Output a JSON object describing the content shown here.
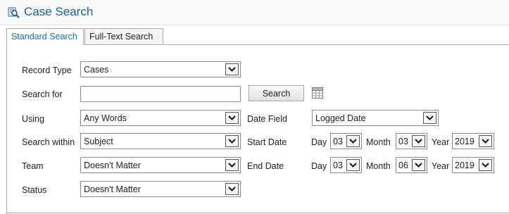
{
  "header": {
    "title": "Case Search",
    "icon": "search-case-icon"
  },
  "tabs": [
    {
      "label": "Standard Search",
      "active": true
    },
    {
      "label": "Full-Text Search",
      "active": false
    }
  ],
  "form": {
    "record_type": {
      "label": "Record Type",
      "value": "Cases"
    },
    "search_for": {
      "label": "Search for",
      "value": "",
      "placeholder": ""
    },
    "search_button": "Search",
    "calendar_icon": "calendar-grid-icon",
    "using": {
      "label": "Using",
      "value": "Any Words"
    },
    "search_within": {
      "label": "Search within",
      "value": "Subject"
    },
    "team": {
      "label": "Team",
      "value": "Doesn't Matter"
    },
    "status": {
      "label": "Status",
      "value": "Doesn't Matter"
    },
    "date_field": {
      "label": "Date Field",
      "value": "Logged Date"
    },
    "start_date": {
      "label": "Start Date",
      "day_label": "Day",
      "day": "03",
      "month_label": "Month",
      "month": "03",
      "year_label": "Year",
      "year": "2019"
    },
    "end_date": {
      "label": "End Date",
      "day_label": "Day",
      "day": "03",
      "month_label": "Month",
      "month": "06",
      "year_label": "Year",
      "year": "2019"
    }
  },
  "colors": {
    "accent": "#1b5fa6",
    "active_tab_text": "#1b6fbd",
    "border": "#a7a7a7"
  }
}
